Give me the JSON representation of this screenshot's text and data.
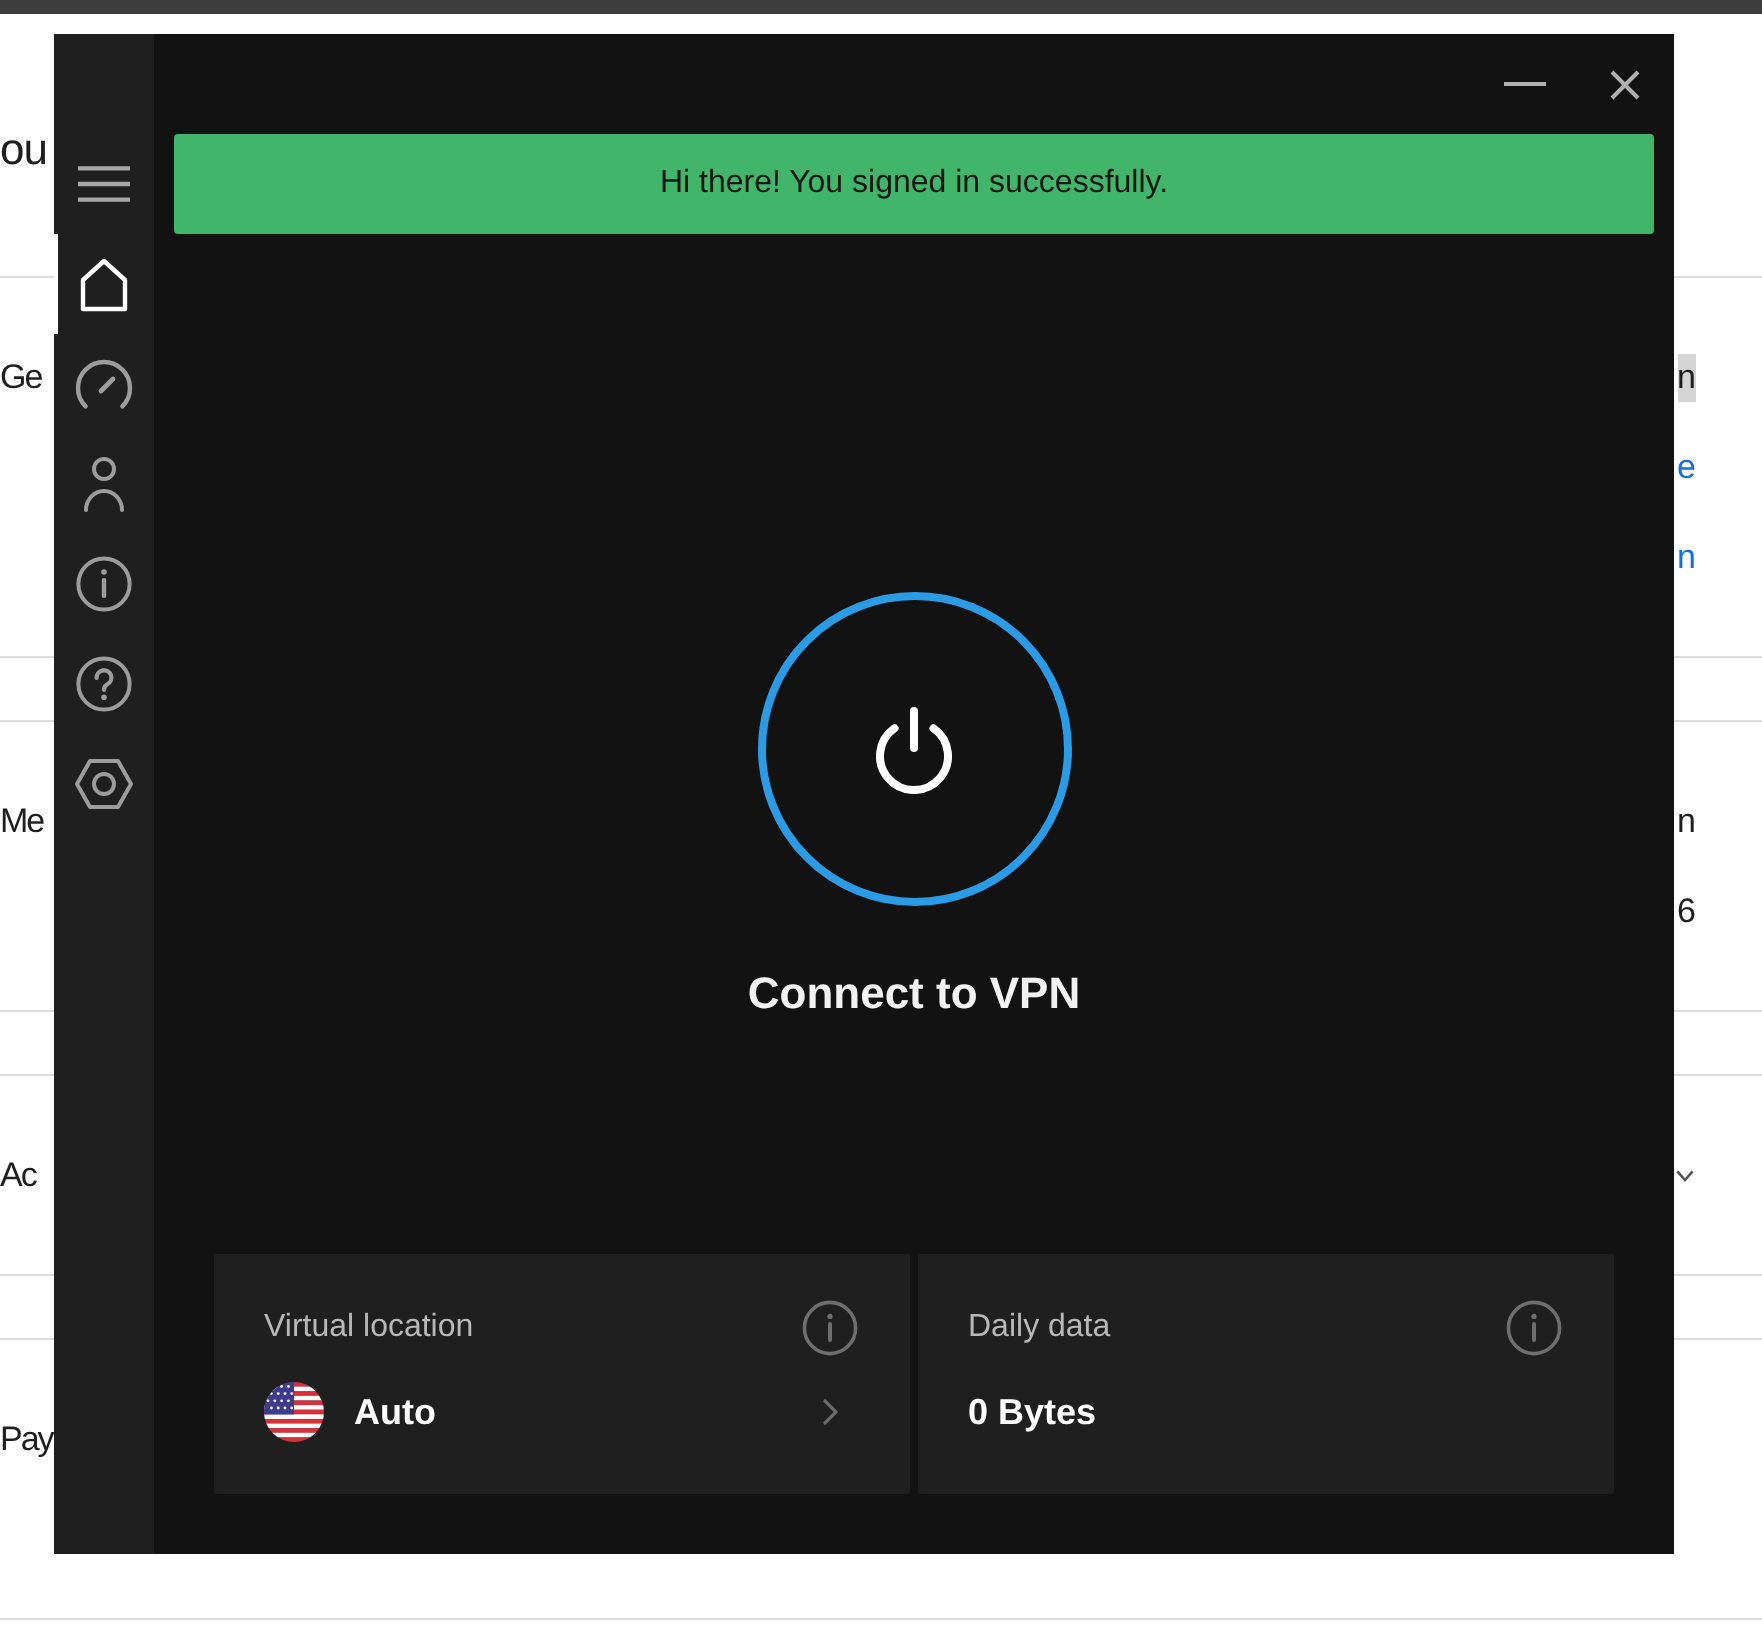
{
  "page": {
    "heading": "ou",
    "rows": [
      {
        "label": "Ge",
        "values": [
          {
            "kind": "highlighted",
            "text": "n"
          },
          {
            "kind": "link",
            "text": "e"
          },
          {
            "kind": "link",
            "text": "n"
          }
        ]
      },
      {
        "label": "Me",
        "values": [
          {
            "kind": "plain",
            "text": "n"
          },
          {
            "kind": "plain",
            "text": "6"
          }
        ]
      },
      {
        "label": "Ac",
        "values": [
          {
            "kind": "chevron"
          }
        ]
      },
      {
        "label": "Pay"
      }
    ]
  },
  "window": {
    "sidebar": {
      "items": [
        {
          "kind": "home",
          "selected": true
        },
        {
          "kind": "speed",
          "selected": false
        },
        {
          "kind": "account",
          "selected": false
        },
        {
          "kind": "info",
          "selected": false
        },
        {
          "kind": "help",
          "selected": false
        },
        {
          "kind": "settings",
          "selected": false
        }
      ]
    },
    "banner": {
      "message": "Hi there! You signed in successfully."
    },
    "connect": {
      "label": "Connect to VPN"
    },
    "cards": [
      {
        "kind": "location",
        "label": "Virtual location",
        "value": "Auto"
      },
      {
        "kind": "data",
        "label": "Daily data",
        "value": "0 Bytes"
      }
    ]
  }
}
